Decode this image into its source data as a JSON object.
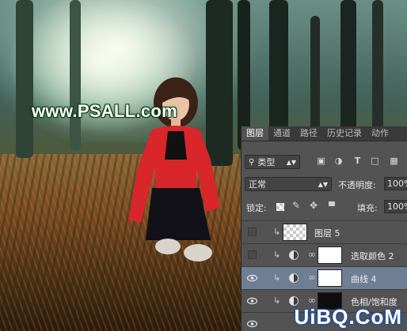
{
  "watermark": {
    "text": "www.PSALL.com"
  },
  "panel": {
    "tabs": [
      "图层",
      "通道",
      "路径",
      "历史记录",
      "动作"
    ],
    "filter": {
      "kind": "类型"
    },
    "blend_mode": "正常",
    "opacity": {
      "label": "不透明度:",
      "value": "100%"
    },
    "lock_label": "锁定:",
    "fill": {
      "label": "填充:",
      "value": "100%"
    },
    "layers": [
      {
        "name": "图层 5",
        "visible": false,
        "type": "pixel",
        "selected": false
      },
      {
        "name": "选取颜色 2",
        "visible": false,
        "type": "adjustment",
        "selected": false
      },
      {
        "name": "曲线 4",
        "visible": true,
        "type": "adjustment",
        "selected": true
      },
      {
        "name": "色相/饱和度",
        "visible": true,
        "type": "adjustment",
        "selected": false
      }
    ]
  },
  "logo": {
    "text": "UiBQ.CoM"
  },
  "icons": [
    "eye-icon",
    "chain-link-icon",
    "adjustment-layer-icon",
    "lock-icon",
    "search-icon",
    "move-icon",
    "brush-icon",
    "checkerboard-lock-icon"
  ]
}
